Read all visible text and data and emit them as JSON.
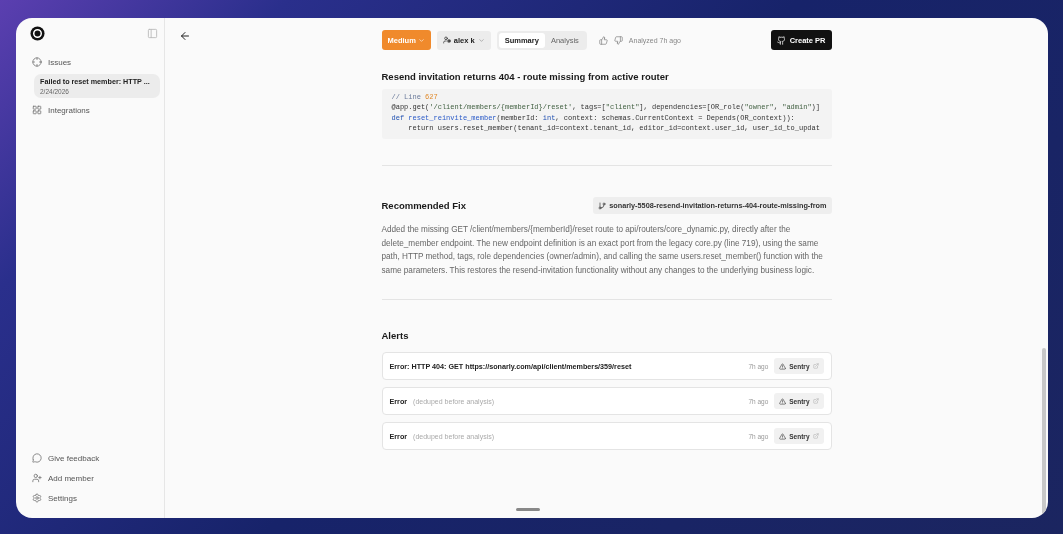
{
  "sidebar": {
    "nav": [
      {
        "label": "Issues",
        "children": [
          {
            "title": "Failed to reset member: HTTP ...",
            "date": "2/24/2026",
            "selected": true
          }
        ]
      },
      {
        "label": "Integrations"
      }
    ],
    "footer": [
      {
        "label": "Give feedback"
      },
      {
        "label": "Add member"
      },
      {
        "label": "Settings"
      }
    ]
  },
  "toolbar": {
    "severity": "Medium",
    "assignee": "alex k",
    "tabs": [
      {
        "label": "Summary",
        "selected": true
      },
      {
        "label": "Analysis",
        "selected": false
      }
    ],
    "analyzed": "Analyzed 7h ago",
    "create_pr": "Create PR"
  },
  "issue": {
    "title": "Resend invitation returns 404 - route missing from active router",
    "code": [
      [
        {
          "text": "// Line ",
          "kind": "comment"
        },
        {
          "text": "627",
          "kind": "number"
        }
      ],
      [
        {
          "text": "@app.get(",
          "kind": "plain"
        },
        {
          "text": "'/client/members/{memberId}/reset'",
          "kind": "string"
        },
        {
          "text": ", tags=[",
          "kind": "plain"
        },
        {
          "text": "\"client\"",
          "kind": "string"
        },
        {
          "text": "], dependencies=[OR_role(",
          "kind": "plain"
        },
        {
          "text": "\"owner\"",
          "kind": "string"
        },
        {
          "text": ", ",
          "kind": "plain"
        },
        {
          "text": "\"admin\"",
          "kind": "string"
        },
        {
          "text": ")]",
          "kind": "plain"
        }
      ],
      [
        {
          "text": "def ",
          "kind": "keyword"
        },
        {
          "text": "reset_reinvite_member",
          "kind": "func"
        },
        {
          "text": "(memberId: ",
          "kind": "plain"
        },
        {
          "text": "int",
          "kind": "keyword"
        },
        {
          "text": ", context: schemas.CurrentContext = Depends(OR_context)):",
          "kind": "plain"
        }
      ],
      [
        {
          "text": "    return users.reset_member(tenant_id=context.tenant_id, editor_id=context.user_id, user_id_to_updat",
          "kind": "plain"
        }
      ]
    ]
  },
  "fix": {
    "title": "Recommended Fix",
    "branch": "sonarly-5508-resend-invitation-returns-404-route-missing-from",
    "description": "Added the missing GET /client/members/{memberId}/reset route to api/routers/core_dynamic.py, directly after the delete_member endpoint. The new endpoint definition is an exact port from the legacy core.py (line 719), using the same path, HTTP method, tags, role dependencies (owner/admin), and calling the same users.reset_member() function with the same parameters. This restores the resend-invitation functionality without any changes to the underlying business logic."
  },
  "alerts": {
    "title": "Alerts",
    "items": [
      {
        "title": "Error: HTTP 404: GET https://sonarly.com/api/client/members/359/reset",
        "time": "7h ago",
        "source": "Sentry"
      },
      {
        "title": "Error",
        "note": "(deduped before analysis)",
        "time": "7h ago",
        "source": "Sentry"
      },
      {
        "title": "Error",
        "note": "(deduped before analysis)",
        "time": "7h ago",
        "source": "Sentry"
      }
    ]
  }
}
